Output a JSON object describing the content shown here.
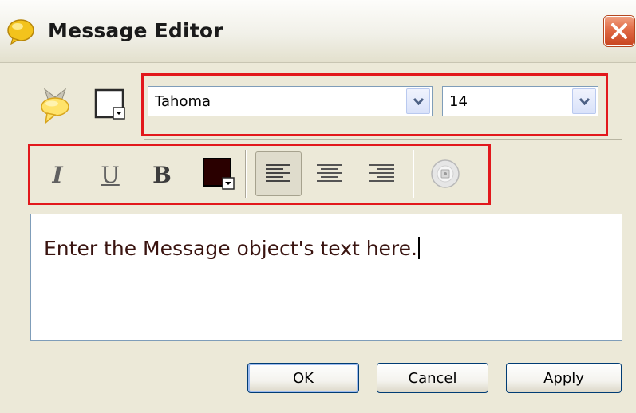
{
  "window": {
    "title": "Message Editor"
  },
  "toolbar": {
    "font_name": "Tahoma",
    "font_size": "14",
    "text_color": "#2a0000",
    "highlight_frame_color": "#e2181c",
    "icons": [
      "speech-bubble-icon",
      "fill-color-icon",
      "italic-icon",
      "underline-icon",
      "bold-icon",
      "text-color-icon",
      "align-left-icon",
      "align-center-icon",
      "align-right-icon",
      "disk-icon"
    ]
  },
  "format": {
    "italic_label": "I",
    "underline_label": "U",
    "bold_label": "B"
  },
  "editor": {
    "text": "Enter the Message object's text here."
  },
  "buttons": {
    "ok": "OK",
    "cancel": "Cancel",
    "apply": "Apply"
  }
}
